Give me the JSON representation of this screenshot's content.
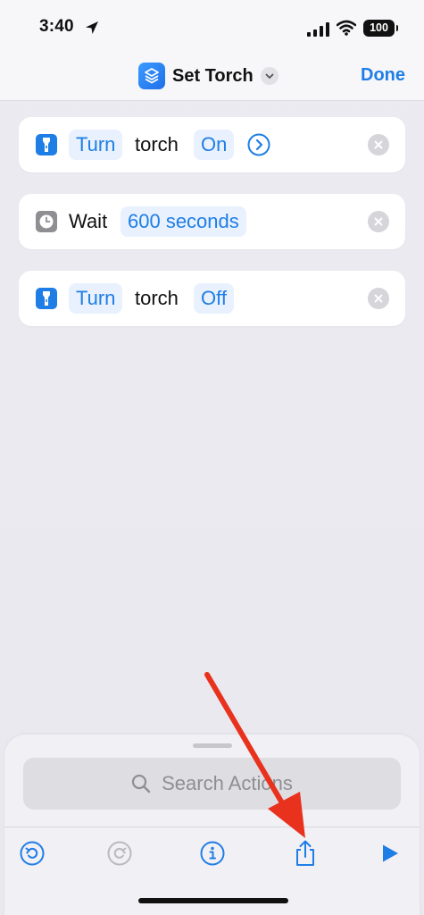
{
  "status_bar": {
    "time": "3:40",
    "battery": "100"
  },
  "nav": {
    "title": "Set Torch",
    "done_label": "Done"
  },
  "actions": [
    {
      "icon": "flashlight-icon",
      "tokens": [
        {
          "text": "Turn",
          "style": "param"
        },
        {
          "text": "torch",
          "style": "plain"
        },
        {
          "text": "On",
          "style": "param"
        }
      ],
      "has_expand_chevron": true
    },
    {
      "icon": "clock-icon",
      "tokens": [
        {
          "text": "Wait",
          "style": "plain"
        },
        {
          "text": "600 seconds",
          "style": "param"
        }
      ],
      "has_expand_chevron": false
    },
    {
      "icon": "flashlight-icon",
      "tokens": [
        {
          "text": "Turn",
          "style": "param"
        },
        {
          "text": "torch",
          "style": "plain"
        },
        {
          "text": "Off",
          "style": "param"
        }
      ],
      "has_expand_chevron": false
    }
  ],
  "search": {
    "placeholder": "Search Actions"
  },
  "toolbar": {
    "buttons": [
      "undo-icon",
      "redo-icon",
      "info-icon",
      "share-icon",
      "play-icon"
    ],
    "redo_enabled": false
  },
  "colors": {
    "accent": "#1f7ee6",
    "token_bg": "#e8f1fd",
    "annotation": "#e8321e"
  }
}
